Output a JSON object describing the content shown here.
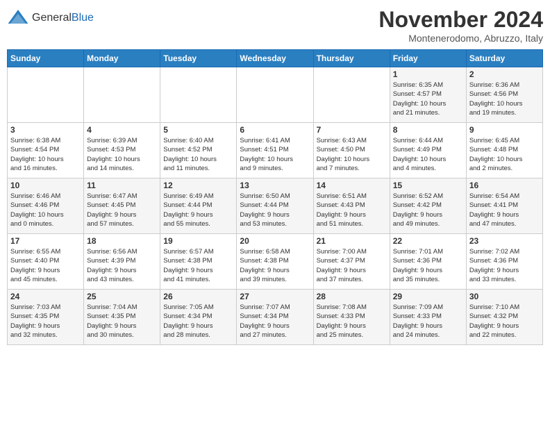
{
  "header": {
    "logo_general": "General",
    "logo_blue": "Blue",
    "month_title": "November 2024",
    "location": "Montenerodomo, Abruzzo, Italy"
  },
  "days_of_week": [
    "Sunday",
    "Monday",
    "Tuesday",
    "Wednesday",
    "Thursday",
    "Friday",
    "Saturday"
  ],
  "weeks": [
    [
      {
        "day": "",
        "info": ""
      },
      {
        "day": "",
        "info": ""
      },
      {
        "day": "",
        "info": ""
      },
      {
        "day": "",
        "info": ""
      },
      {
        "day": "",
        "info": ""
      },
      {
        "day": "1",
        "info": "Sunrise: 6:35 AM\nSunset: 4:57 PM\nDaylight: 10 hours\nand 21 minutes."
      },
      {
        "day": "2",
        "info": "Sunrise: 6:36 AM\nSunset: 4:56 PM\nDaylight: 10 hours\nand 19 minutes."
      }
    ],
    [
      {
        "day": "3",
        "info": "Sunrise: 6:38 AM\nSunset: 4:54 PM\nDaylight: 10 hours\nand 16 minutes."
      },
      {
        "day": "4",
        "info": "Sunrise: 6:39 AM\nSunset: 4:53 PM\nDaylight: 10 hours\nand 14 minutes."
      },
      {
        "day": "5",
        "info": "Sunrise: 6:40 AM\nSunset: 4:52 PM\nDaylight: 10 hours\nand 11 minutes."
      },
      {
        "day": "6",
        "info": "Sunrise: 6:41 AM\nSunset: 4:51 PM\nDaylight: 10 hours\nand 9 minutes."
      },
      {
        "day": "7",
        "info": "Sunrise: 6:43 AM\nSunset: 4:50 PM\nDaylight: 10 hours\nand 7 minutes."
      },
      {
        "day": "8",
        "info": "Sunrise: 6:44 AM\nSunset: 4:49 PM\nDaylight: 10 hours\nand 4 minutes."
      },
      {
        "day": "9",
        "info": "Sunrise: 6:45 AM\nSunset: 4:48 PM\nDaylight: 10 hours\nand 2 minutes."
      }
    ],
    [
      {
        "day": "10",
        "info": "Sunrise: 6:46 AM\nSunset: 4:46 PM\nDaylight: 10 hours\nand 0 minutes."
      },
      {
        "day": "11",
        "info": "Sunrise: 6:47 AM\nSunset: 4:45 PM\nDaylight: 9 hours\nand 57 minutes."
      },
      {
        "day": "12",
        "info": "Sunrise: 6:49 AM\nSunset: 4:44 PM\nDaylight: 9 hours\nand 55 minutes."
      },
      {
        "day": "13",
        "info": "Sunrise: 6:50 AM\nSunset: 4:44 PM\nDaylight: 9 hours\nand 53 minutes."
      },
      {
        "day": "14",
        "info": "Sunrise: 6:51 AM\nSunset: 4:43 PM\nDaylight: 9 hours\nand 51 minutes."
      },
      {
        "day": "15",
        "info": "Sunrise: 6:52 AM\nSunset: 4:42 PM\nDaylight: 9 hours\nand 49 minutes."
      },
      {
        "day": "16",
        "info": "Sunrise: 6:54 AM\nSunset: 4:41 PM\nDaylight: 9 hours\nand 47 minutes."
      }
    ],
    [
      {
        "day": "17",
        "info": "Sunrise: 6:55 AM\nSunset: 4:40 PM\nDaylight: 9 hours\nand 45 minutes."
      },
      {
        "day": "18",
        "info": "Sunrise: 6:56 AM\nSunset: 4:39 PM\nDaylight: 9 hours\nand 43 minutes."
      },
      {
        "day": "19",
        "info": "Sunrise: 6:57 AM\nSunset: 4:38 PM\nDaylight: 9 hours\nand 41 minutes."
      },
      {
        "day": "20",
        "info": "Sunrise: 6:58 AM\nSunset: 4:38 PM\nDaylight: 9 hours\nand 39 minutes."
      },
      {
        "day": "21",
        "info": "Sunrise: 7:00 AM\nSunset: 4:37 PM\nDaylight: 9 hours\nand 37 minutes."
      },
      {
        "day": "22",
        "info": "Sunrise: 7:01 AM\nSunset: 4:36 PM\nDaylight: 9 hours\nand 35 minutes."
      },
      {
        "day": "23",
        "info": "Sunrise: 7:02 AM\nSunset: 4:36 PM\nDaylight: 9 hours\nand 33 minutes."
      }
    ],
    [
      {
        "day": "24",
        "info": "Sunrise: 7:03 AM\nSunset: 4:35 PM\nDaylight: 9 hours\nand 32 minutes."
      },
      {
        "day": "25",
        "info": "Sunrise: 7:04 AM\nSunset: 4:35 PM\nDaylight: 9 hours\nand 30 minutes."
      },
      {
        "day": "26",
        "info": "Sunrise: 7:05 AM\nSunset: 4:34 PM\nDaylight: 9 hours\nand 28 minutes."
      },
      {
        "day": "27",
        "info": "Sunrise: 7:07 AM\nSunset: 4:34 PM\nDaylight: 9 hours\nand 27 minutes."
      },
      {
        "day": "28",
        "info": "Sunrise: 7:08 AM\nSunset: 4:33 PM\nDaylight: 9 hours\nand 25 minutes."
      },
      {
        "day": "29",
        "info": "Sunrise: 7:09 AM\nSunset: 4:33 PM\nDaylight: 9 hours\nand 24 minutes."
      },
      {
        "day": "30",
        "info": "Sunrise: 7:10 AM\nSunset: 4:32 PM\nDaylight: 9 hours\nand 22 minutes."
      }
    ]
  ]
}
